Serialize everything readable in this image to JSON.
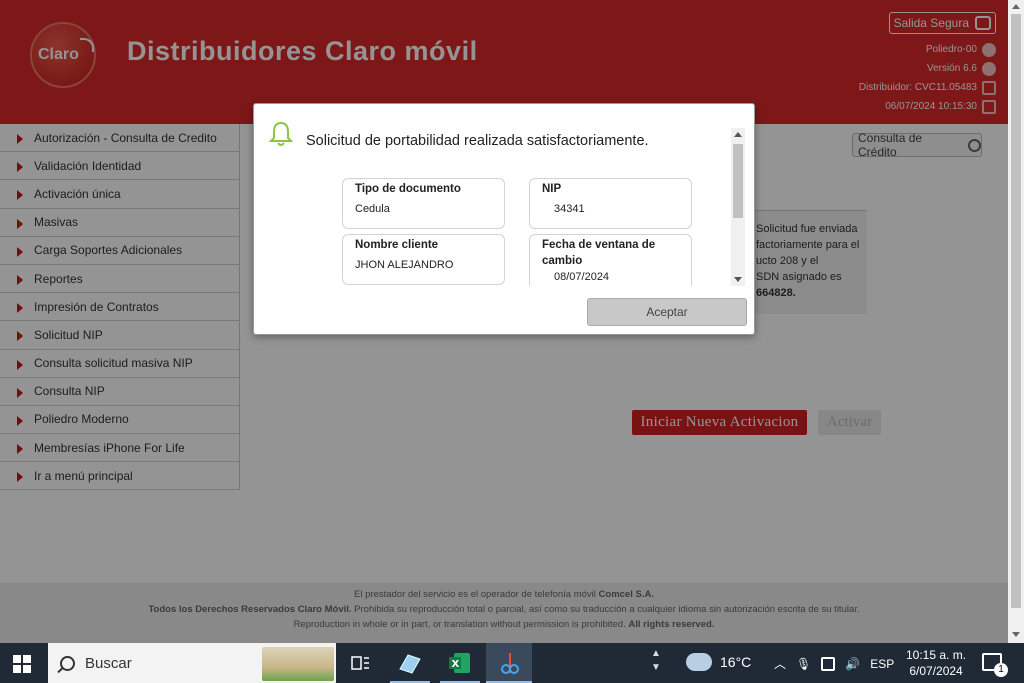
{
  "header": {
    "logo_text": "Claro",
    "title": "Distribuidores Claro móvil",
    "safe_exit_label": "Salida Segura",
    "poliedro": "Poliedro-00",
    "version": "Versión 6.6",
    "distributor": "Distribuidor: CVC11.05483",
    "datetime": "06/07/2024 10:15:30"
  },
  "sidebar": {
    "items": [
      {
        "label": "Autorización - Consulta de Credito"
      },
      {
        "label": "Validación Identidad"
      },
      {
        "label": "Activación única"
      },
      {
        "label": "Masivas"
      },
      {
        "label": "Carga Soportes Adicionales"
      },
      {
        "label": "Reportes"
      },
      {
        "label": "Impresión de Contratos"
      },
      {
        "label": "Solicitud NIP"
      },
      {
        "label": "Consulta solicitud masiva NIP"
      },
      {
        "label": "Consulta NIP"
      },
      {
        "label": "Poliedro Moderno"
      },
      {
        "label": "Membresías iPhone For Life"
      },
      {
        "label": "Ir a menú principal"
      }
    ]
  },
  "main": {
    "consulta_credito_label": "Consulta de Crédito",
    "result_lines": [
      "Solicitud fue enviada",
      "factoriamente para el",
      "ucto 208 y el",
      "SDN asignado es"
    ],
    "result_number": "664828.",
    "btn_nueva": "Iniciar Nueva Activacion",
    "btn_activar": "Activar"
  },
  "footer": {
    "line1_a": "El prestador del servicio es el operador de telefonía móvil ",
    "line1_b": "Comcel S.A.",
    "line2_a": "Todos los Derechos Reservados Claro Móvil.",
    "line2_b": " Prohibida su reproducción total o parcial, así como su traducción a cualquier idioma sin autorización escrita de su titular.",
    "line3_a": "Reproduction in whole or in part, or translation without permission is prohibited. ",
    "line3_b": "All rights reserved."
  },
  "modal": {
    "message": "Solicitud de portabilidad realizada satisfactoriamente.",
    "fields": {
      "tipo_doc_label": "Tipo de documento",
      "tipo_doc_value": "Cedula",
      "nip_label": "NIP",
      "nip_value": "34341",
      "nombre_label": "Nombre cliente",
      "nombre_value": "JHON ALEJANDRO",
      "fecha_label": "Fecha de ventana de cambio",
      "fecha_value": "08/07/2024"
    },
    "accept_label": "Aceptar"
  },
  "taskbar": {
    "search_placeholder": "Buscar",
    "temperature": "16°C",
    "language": "ESP",
    "time": "10:15 a. m.",
    "date": "6/07/2024",
    "notification_count": "1"
  }
}
